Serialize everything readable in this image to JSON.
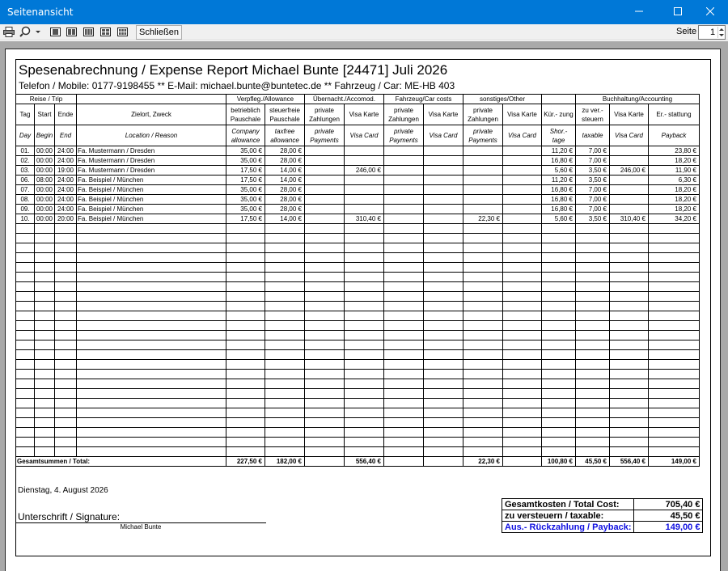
{
  "window": {
    "title": "Seitenansicht"
  },
  "toolbar": {
    "close_label": "Schließen",
    "page_label": "Seite",
    "page_value": "1"
  },
  "report": {
    "title": "Spesenabrechnung / Expense Report Michael Bunte [24471]    Juli 2026",
    "subtitle": "Telefon / Mobile: 0177-9198455 ** E-Mail: michael.bunte@buntetec.de ** Fahrzeug / Car: ME-HB 403",
    "group_headers": [
      "Reise / Trip",
      "",
      "Verpfleg./Allowance",
      "Übernacht./Accomod.",
      "Fahrzeug/Car costs",
      "sonstiges/Other",
      "",
      "Buchhaltung/Accounting"
    ],
    "columns_de": [
      "Tag",
      "Start",
      "Ende",
      "Zielort, Zweck",
      "betrieblich Pauschale",
      "steuerfreie Pauschale",
      "private Zahlungen",
      "Visa Karte",
      "private Zahlungen",
      "Visa Karte",
      "private Zahlungen",
      "Visa Karte",
      "Kür.- zung",
      "zu ver.- steuern",
      "Visa Karte",
      "Er.- stattung"
    ],
    "columns_en": [
      "Day",
      "Begin",
      "End",
      "Location / Reason",
      "Company allowance",
      "taxfree allowance",
      "private Payments",
      "Visa Card",
      "private Payments",
      "Visa Card",
      "private Payments",
      "Visa Card",
      "Shor.- tage",
      "taxable",
      "Visa Card",
      "Payback"
    ],
    "rows": [
      [
        "01.",
        "00:00",
        "24:00",
        "Fa. Mustermann / Dresden",
        "35,00 €",
        "28,00 €",
        "",
        "",
        "",
        "",
        "",
        "",
        "11,20 €",
        "7,00 €",
        "",
        "23,80 €"
      ],
      [
        "02.",
        "00:00",
        "24:00",
        "Fa. Mustermann / Dresden",
        "35,00 €",
        "28,00 €",
        "",
        "",
        "",
        "",
        "",
        "",
        "16,80 €",
        "7,00 €",
        "",
        "18,20 €"
      ],
      [
        "03.",
        "00:00",
        "19:00",
        "Fa. Mustermann / Dresden",
        "17,50 €",
        "14,00 €",
        "",
        "246,00 €",
        "",
        "",
        "",
        "",
        "5,60 €",
        "3,50 €",
        "246,00 €",
        "11,90 €"
      ],
      [
        "06.",
        "08:00",
        "24:00",
        "Fa. Beispiel / München",
        "17,50 €",
        "14,00 €",
        "",
        "",
        "",
        "",
        "",
        "",
        "11,20 €",
        "3,50 €",
        "",
        "6,30 €"
      ],
      [
        "07.",
        "00:00",
        "24:00",
        "Fa. Beispiel / München",
        "35,00 €",
        "28,00 €",
        "",
        "",
        "",
        "",
        "",
        "",
        "16,80 €",
        "7,00 €",
        "",
        "18,20 €"
      ],
      [
        "08.",
        "00:00",
        "24:00",
        "Fa. Beispiel / München",
        "35,00 €",
        "28,00 €",
        "",
        "",
        "",
        "",
        "",
        "",
        "16,80 €",
        "7,00 €",
        "",
        "18,20 €"
      ],
      [
        "09.",
        "00:00",
        "24:00",
        "Fa. Beispiel / München",
        "35,00 €",
        "28,00 €",
        "",
        "",
        "",
        "",
        "",
        "",
        "16,80 €",
        "7,00 €",
        "",
        "18,20 €"
      ],
      [
        "10.",
        "00:00",
        "20:00",
        "Fa. Beispiel / München",
        "17,50 €",
        "14,00 €",
        "",
        "310,40 €",
        "",
        "",
        "22,30 €",
        "",
        "5,60 €",
        "3,50 €",
        "310,40 €",
        "34,20 €"
      ]
    ],
    "totals_label": "Gesamtsummen / Total:",
    "totals": [
      "227,50 €",
      "182,00 €",
      "",
      "556,40 €",
      "",
      "",
      "22,30 €",
      "",
      "100,80 €",
      "45,50 €",
      "556,40 €",
      "149,00 €"
    ],
    "date": "Dienstag, 4. August 2026",
    "signature_label": "Unterschrift / Signature:",
    "signature_name": "Michael Bunte",
    "summary": [
      {
        "label": "Gesamtkosten / Total Cost:",
        "value": "705,40 €"
      },
      {
        "label": "zu versteuern / taxable:",
        "value": "45,50 €"
      },
      {
        "label": "Aus.- Rückzahlung / Payback:",
        "value": "149,00 €"
      }
    ]
  },
  "colors": {
    "titlebar": "#0078d7",
    "payback": "#1010e0",
    "viewer_bg": "#a9a9a9"
  },
  "icons": [
    "print-icon",
    "zoom-icon",
    "one-page-icon",
    "two-page-icon",
    "three-page-icon",
    "four-page-icon",
    "six-page-icon",
    "minimize-icon",
    "maximize-icon",
    "close-icon"
  ]
}
